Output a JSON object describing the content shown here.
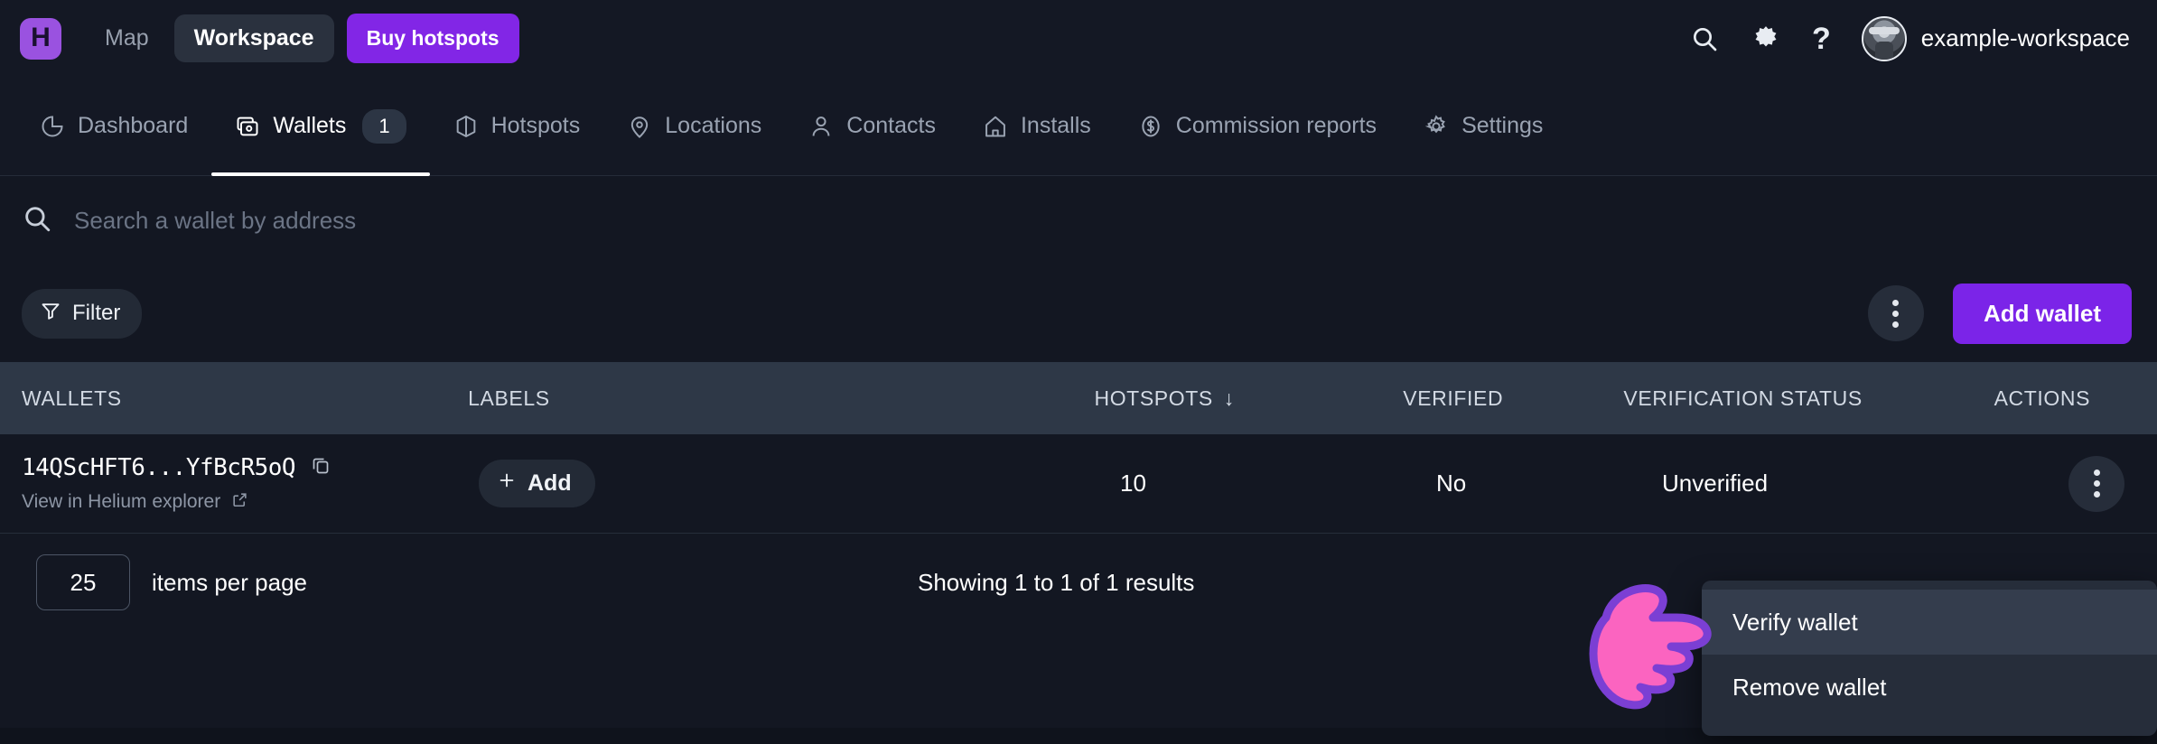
{
  "header": {
    "logo_letter": "H",
    "nav": [
      {
        "label": "Map",
        "type": "link"
      },
      {
        "label": "Workspace",
        "type": "pill"
      },
      {
        "label": "Buy hotspots",
        "type": "cta"
      }
    ],
    "icons": [
      "search-icon",
      "gear-icon",
      "help-icon"
    ],
    "help_glyph": "?",
    "workspace_name": "example-workspace"
  },
  "tabs": [
    {
      "label": "Dashboard",
      "icon": "pie-chart-icon",
      "active": false
    },
    {
      "label": "Wallets",
      "icon": "wallet-icon",
      "active": true,
      "badge": "1"
    },
    {
      "label": "Hotspots",
      "icon": "cube-icon",
      "active": false
    },
    {
      "label": "Locations",
      "icon": "map-pin-icon",
      "active": false
    },
    {
      "label": "Contacts",
      "icon": "user-icon",
      "active": false
    },
    {
      "label": "Installs",
      "icon": "home-icon",
      "active": false
    },
    {
      "label": "Commission reports",
      "icon": "dollar-circle-icon",
      "active": false
    },
    {
      "label": "Settings",
      "icon": "gear-icon",
      "active": false
    }
  ],
  "search": {
    "placeholder": "Search a wallet by address",
    "value": ""
  },
  "toolbar": {
    "filter_label": "Filter",
    "add_wallet_label": "Add wallet",
    "overflow_label": "More options"
  },
  "table": {
    "columns": [
      "WALLETS",
      "LABELS",
      "HOTSPOTS",
      "VERIFIED",
      "VERIFICATION STATUS",
      "ACTIONS"
    ],
    "sorted_column": "HOTSPOTS",
    "sort_glyph": "↓",
    "rows": [
      {
        "wallet": "14QScHFT6...YfBcR5oQ",
        "explorer_link": "View in Helium explorer",
        "label_add": "Add",
        "hotspots": "10",
        "verified": "No",
        "verification_status": "Unverified"
      }
    ]
  },
  "footer": {
    "items_per_page_value": "25",
    "items_per_page_label": "items per page",
    "showing": "Showing 1 to 1 of 1 results"
  },
  "context_menu": {
    "items": [
      {
        "label": "Verify wallet",
        "highlighted": true
      },
      {
        "label": "Remove wallet",
        "highlighted": false
      }
    ]
  },
  "colors": {
    "page_bg": "#131722",
    "header_bg": "#141824",
    "table_head_bg": "#2e3847",
    "accent_purple": "#7b24e8",
    "cta_purple": "#8226e6",
    "logo_purple": "#9a52e0",
    "menu_bg": "#262d3a",
    "menu_highlight": "#343d4d",
    "cursor_pink": "#fb64c0",
    "cursor_outline": "#7b3fd4"
  }
}
